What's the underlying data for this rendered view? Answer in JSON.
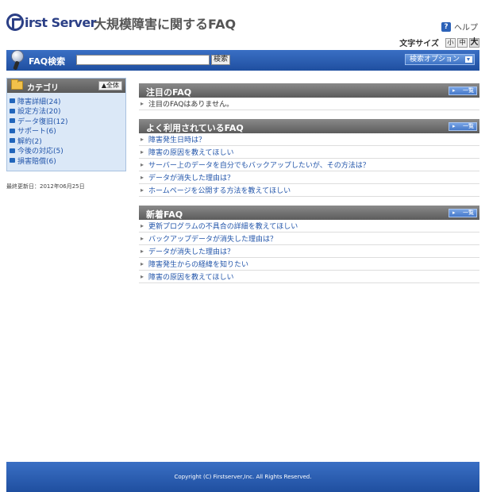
{
  "header": {
    "logo_text": "irst Server",
    "site_title": "大規模障害に関するFAQ",
    "help_label": "ヘルプ",
    "help_icon": "?",
    "font_size_label": "文字サイズ",
    "font_sizes": [
      "小",
      "中",
      "大"
    ]
  },
  "search": {
    "label": "FAQ検索",
    "input_value": "",
    "button_label": "検索",
    "options_label": "検索オプション"
  },
  "sidebar": {
    "title": "カテゴリ",
    "all_label": "全体",
    "items": [
      {
        "label": "障害詳細(24)"
      },
      {
        "label": "設定方法(20)"
      },
      {
        "label": "データ復旧(12)"
      },
      {
        "label": "サポート(6)"
      },
      {
        "label": "解約(2)"
      },
      {
        "label": "今後の対応(5)"
      },
      {
        "label": "損害賠償(6)"
      }
    ],
    "last_updated": "最終更新日：2012年06月25日"
  },
  "sections": {
    "featured": {
      "title": "注目のFAQ",
      "more_label": "一覧",
      "items": [
        "注目のFAQはありません。"
      ]
    },
    "popular": {
      "title": "よく利用されているFAQ",
      "more_label": "一覧",
      "items": [
        "障害発生日時は？",
        "障害の原因を教えてほしい",
        "サーバー上のデータを自分でもバックアップしたいが、その方法は？",
        "データが消失した理由は？",
        "ホームページを公開する方法を教えてほしい"
      ]
    },
    "new": {
      "title": "新着FAQ",
      "more_label": "一覧",
      "items": [
        "更新プログラムの不具合の詳細を教えてほしい",
        "バックアップデータが消失した理由は？",
        "データが消失した理由は？",
        "障害発生からの経緯を知りたい",
        "障害の原因を教えてほしい"
      ]
    }
  },
  "footer": {
    "copyright": "Copyright (C) Firstserver,Inc. All Rights Reserved."
  },
  "colors": {
    "brand_blue": "#1f4fa0",
    "link_blue": "#2255aa",
    "section_gray": "#5c5c5c",
    "sidebar_bg": "#dbe8f7"
  }
}
